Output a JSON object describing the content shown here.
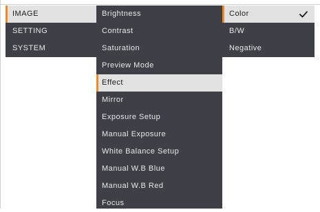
{
  "menu": {
    "categories": [
      {
        "label": "IMAGE",
        "selected": true
      },
      {
        "label": "SETTING",
        "selected": false
      },
      {
        "label": "SYSTEM",
        "selected": false
      }
    ],
    "image_items": [
      {
        "label": "Brightness",
        "selected": false
      },
      {
        "label": "Contrast",
        "selected": false
      },
      {
        "label": "Saturation",
        "selected": false
      },
      {
        "label": "Preview Mode",
        "selected": false
      },
      {
        "label": "Effect",
        "selected": true
      },
      {
        "label": "Mirror",
        "selected": false
      },
      {
        "label": "Exposure Setup",
        "selected": false
      },
      {
        "label": "Manual Exposure",
        "selected": false
      },
      {
        "label": "White Balance Setup",
        "selected": false
      },
      {
        "label": "Manual W.B Blue",
        "selected": false
      },
      {
        "label": "Manual W.B Red",
        "selected": false
      },
      {
        "label": "Focus",
        "selected": false
      }
    ],
    "effect_options": [
      {
        "label": "Color",
        "selected": true,
        "checked": true
      },
      {
        "label": "B/W",
        "selected": false,
        "checked": false
      },
      {
        "label": "Negative",
        "selected": false,
        "checked": false
      }
    ]
  },
  "icons": {
    "check": "check-icon"
  },
  "colors": {
    "menu_background": "#3f4047",
    "menu_text": "#e8e8e8",
    "selected_background": "#e2e2e2",
    "selected_text": "#1a1a1a",
    "selection_accent": "#f08a24"
  }
}
